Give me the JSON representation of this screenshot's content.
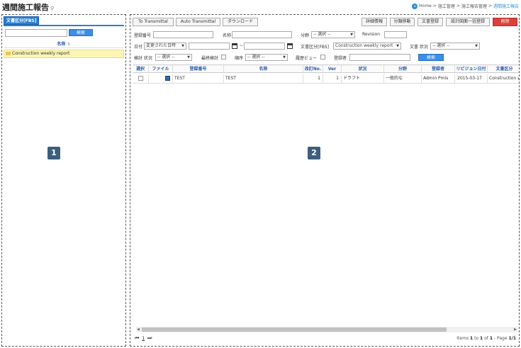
{
  "page": {
    "title": "週間施工報告",
    "pin_icon": "pin-icon"
  },
  "breadcrumb": {
    "home": "Home",
    "level1": "施工管理",
    "level2": "施工報告管理",
    "current": "週間施工報告"
  },
  "left_panel": {
    "tab": "文書区分[FBS]",
    "search_value": "",
    "search_button": "検索",
    "column_header": "名称",
    "items": [
      "Construction weekly report"
    ],
    "badge": "1"
  },
  "right_panel": {
    "badge": "2",
    "toolbar": {
      "to_transmittal": "To Transmittal",
      "auto_transmittal": "Auto Transmittal",
      "download": "ダウンロード",
      "detail_info": "詳細情報",
      "move_category": "分類移動",
      "doc_register": "文書登録",
      "bulk_register": "設計図面一括登録",
      "delete": "削除"
    },
    "filters": {
      "reg_no_label": "登録番号",
      "name_label": "名称",
      "field_label": "分野",
      "field_value": "-- 選択 --",
      "revision_label": "Revision",
      "date_label": "日付",
      "date_value": "変更された日時",
      "date_separator": "~",
      "doc_cat_label": "文書区分[FBS]",
      "doc_cat_value": "Construction weekly report",
      "doc_status_label": "文書 状況",
      "doc_status_value": "-- 選択 --",
      "review_status_label": "検討 状況",
      "review_status_value": "-- 選択 --",
      "final_review_label": "最終検討",
      "order_label": "順序",
      "order_value": "-- 選択 --",
      "history_view_label": "履歴ビュー",
      "registrant_label": "登録者",
      "search_button": "検索"
    },
    "columns": [
      "選択",
      "ファイル",
      "登録番号",
      "名称",
      "改訂No.",
      "Ver",
      "状況",
      "分野",
      "登録者",
      "リビジョン日付",
      "文書区分"
    ],
    "rows": [
      {
        "reg_no": "TEST",
        "name": "TEST",
        "rev": "1",
        "ver": "1",
        "status": "ドラフト",
        "field": "一般的な",
        "registrant": "Admin Pmis",
        "rev_date": "2015-03-17",
        "doc_cat": "Construction weekly"
      }
    ],
    "pager": {
      "current_page": "1",
      "info_prefix": "Items",
      "from": "1",
      "to": "1",
      "of": "1",
      "page_label": "Page",
      "page_value": "1/1"
    }
  }
}
